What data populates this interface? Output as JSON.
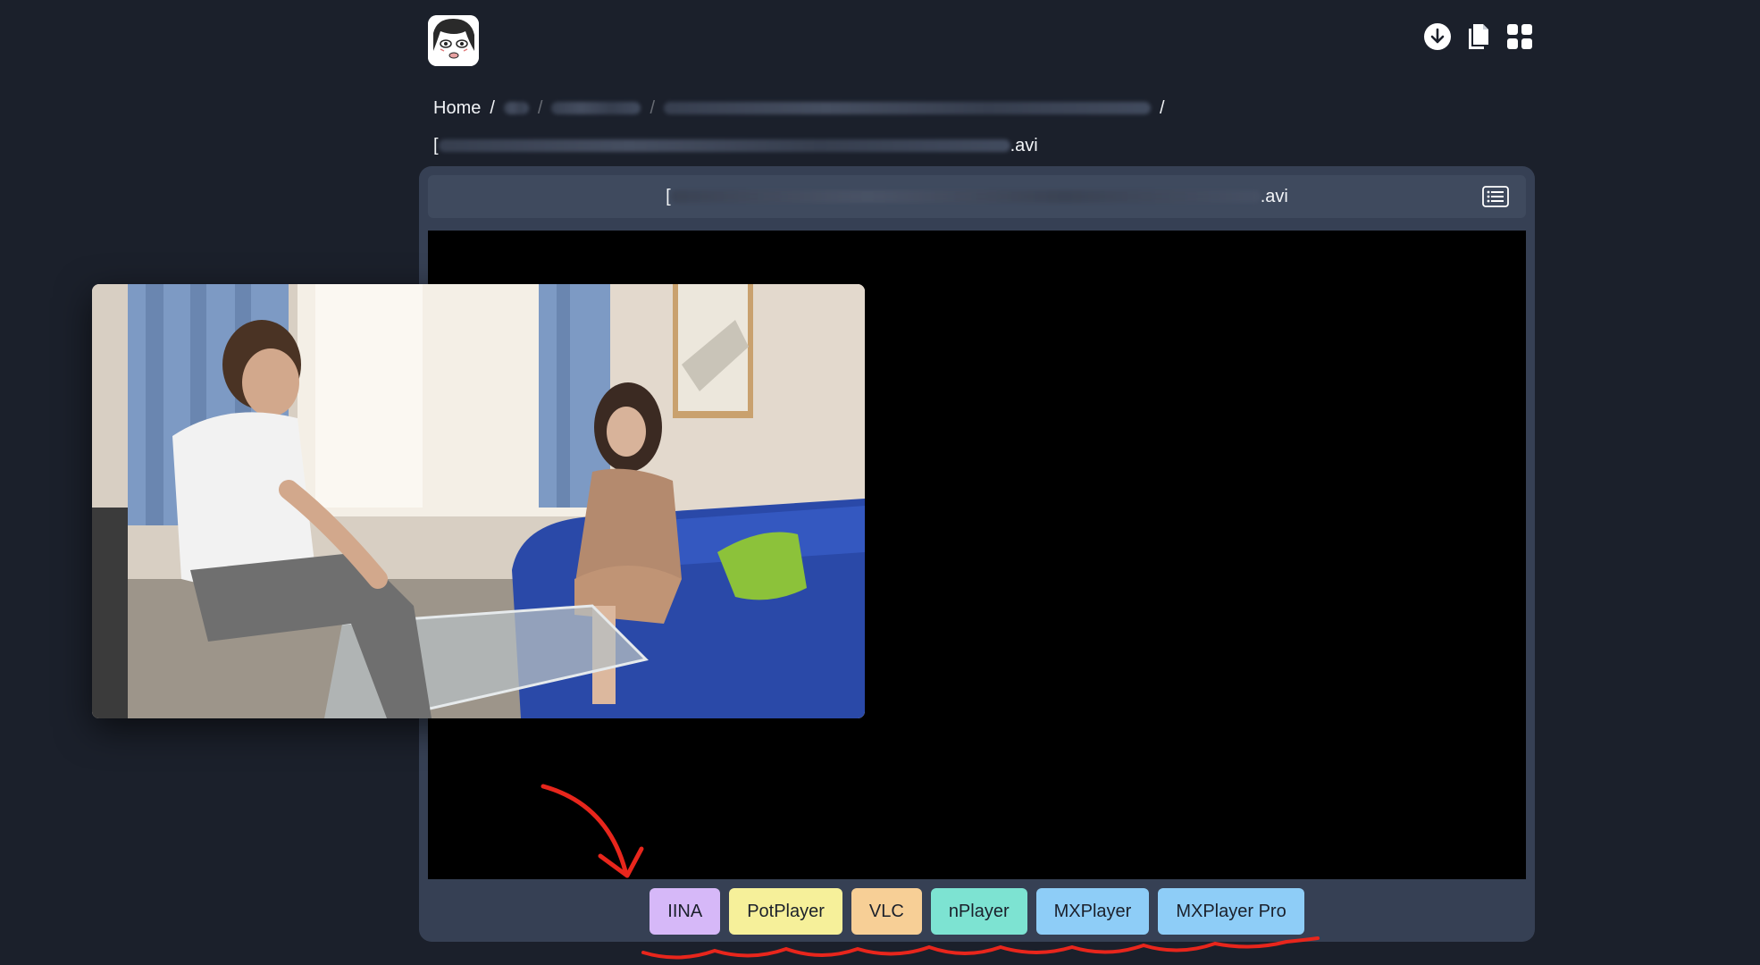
{
  "header": {
    "logo_icon": "anime-face-logo",
    "icons": [
      "download-circle-icon",
      "copy-documents-icon",
      "grid-apps-icon"
    ]
  },
  "breadcrumb": {
    "home": "Home",
    "separator": "/",
    "file_prefix": "[",
    "file_suffix": ".avi"
  },
  "player": {
    "title_prefix": "[",
    "title_suffix": ".avi",
    "list_icon": "playlist-icon",
    "external_players": [
      {
        "label": "IINA",
        "color": "#d6b8f8"
      },
      {
        "label": "PotPlayer",
        "color": "#f6f09a"
      },
      {
        "label": "VLC",
        "color": "#f7cf96"
      },
      {
        "label": "nPlayer",
        "color": "#7de3d2"
      },
      {
        "label": "MXPlayer",
        "color": "#8ecdf7"
      },
      {
        "label": "MXPlayer Pro",
        "color": "#8ecdf7"
      }
    ]
  },
  "colors": {
    "background": "#1b202b",
    "card": "#364054",
    "annotation": "#e8261c"
  }
}
